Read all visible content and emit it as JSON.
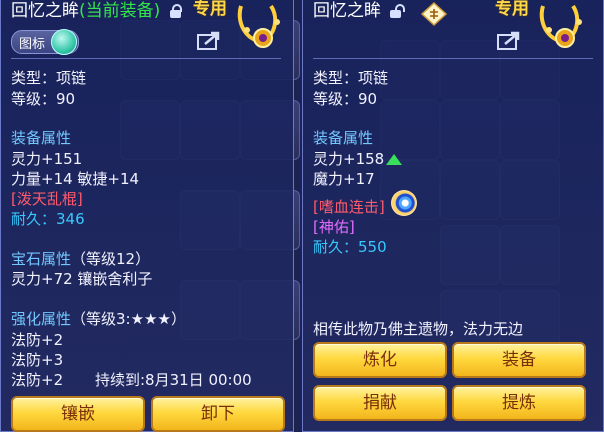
{
  "left": {
    "title_main": "回忆之眸",
    "title_note": "(当前装备)",
    "special": "专用",
    "icon_toggle_label": "图标",
    "type": "类型：项链",
    "level": "等级：90",
    "equip_attr_header": "装备属性",
    "attr1": "灵力+151",
    "attr2": "力量+14 敏捷+14",
    "skill": "[泼天乱棍]",
    "durability": "耐久：346",
    "gem_header": "宝石属性",
    "gem_level": "（等级12）",
    "gem_attr": "灵力+72 镶嵌舍利子",
    "enhance_header": "强化属性",
    "enhance_level": "（等级3:★★★）",
    "enh1": "法防+2",
    "enh2": "法防+3",
    "enh3": "法防+2",
    "duration": "持续到:8月31日 00:00",
    "buttons": [
      "镶嵌",
      "卸下"
    ]
  },
  "right": {
    "title_main": "回忆之眸",
    "special": "专用",
    "type": "类型：项链",
    "level": "等级：90",
    "equip_attr_header": "装备属性",
    "attr1": "灵力+158",
    "attr2": "魔力+17",
    "skill": "[嗜血连击]",
    "tag": "[神佑]",
    "durability": "耐久：550",
    "description": "相传此物乃佛主遗物，法力无边",
    "buttons": [
      "炼化",
      "装备",
      "捐献",
      "提炼"
    ]
  },
  "colors": {
    "current_equipped": "#33e54a",
    "section_header": "#73c8ff",
    "skill": "#ff5b6b",
    "tag": "#e36cff",
    "durability": "#37c9ff",
    "button_gold": "#ffd83f",
    "stat_up_arrow": "#38e05c"
  },
  "icons": {
    "left_lock": "lock-icon",
    "right_lock": "unlock-icon",
    "share": "share-icon",
    "ping": "ping-button-icon",
    "necklace": "necklace-item-icon",
    "stat_up": "arrow-up-icon",
    "skill_effect": "swirl-skill-icon"
  }
}
